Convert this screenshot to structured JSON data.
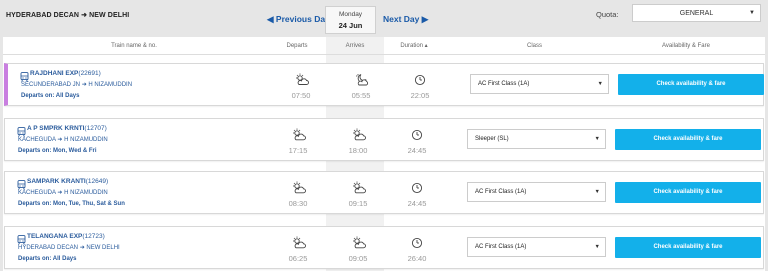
{
  "header": {
    "from": "HYDERABAD DECAN",
    "to": "NEW DELHI",
    "route_arrow": "➜",
    "prev_day": "Previous Day",
    "next_day": "Next Day",
    "date_dow": "Monday",
    "date_dm": "24 Jun",
    "quota_label": "Quota:",
    "quota_value": "GENERAL"
  },
  "columns": {
    "train": "Train name & no.",
    "departs": "Departs",
    "arrives": "Arrives",
    "duration": "Duration ▴",
    "class": "Class",
    "availability": "Availability & Fare"
  },
  "trains": [
    {
      "name": "RAJDHANI EXP",
      "number": "(22691)",
      "from": "SECUNDERABAD JN",
      "to": "H NIZAMUDDIN",
      "runs": "Departs on: All Days",
      "departs": "07:50",
      "arrives": "05:55",
      "duration": "22:05",
      "class": "AC First Class (1A)",
      "button": "Check availability & fare",
      "depart_icon": "sun-icon",
      "arrive_icon": "moon-icon"
    },
    {
      "name": "A P SMPRK KRNTI",
      "number": "(12707)",
      "from": "KACHEGUDA",
      "to": "H NIZAMUDDIN",
      "runs": "Departs on: Mon, Wed & Fri",
      "departs": "17:15",
      "arrives": "18:00",
      "duration": "24:45",
      "class": "Sleeper (SL)",
      "button": "Check availability & fare",
      "depart_icon": "cloud-sun-icon",
      "arrive_icon": "cloud-sun-icon"
    },
    {
      "name": "SAMPARK KRANTI",
      "number": "(12649)",
      "from": "KACHEGUDA",
      "to": "H NIZAMUDDIN",
      "runs": "Departs on: Mon, Tue, Thu, Sat & Sun",
      "departs": "08:30",
      "arrives": "09:15",
      "duration": "24:45",
      "class": "AC First Class (1A)",
      "button": "Check availability & fare",
      "depart_icon": "cloud-sun-icon",
      "arrive_icon": "cloud-sun-icon"
    },
    {
      "name": "TELANGANA EXP",
      "number": "(12723)",
      "from": "HYDERABAD DECAN",
      "to": "NEW DELHI",
      "runs": "Departs on: All Days",
      "departs": "06:25",
      "arrives": "09:05",
      "duration": "26:40",
      "class": "AC First Class (1A)",
      "button": "Check availability & fare",
      "depart_icon": "cloud-sun-icon",
      "arrive_icon": "cloud-sun-icon"
    }
  ],
  "colors": {
    "link": "#2a5b9c",
    "button": "#13b0ea",
    "selected_marker": "#c97fe0"
  }
}
